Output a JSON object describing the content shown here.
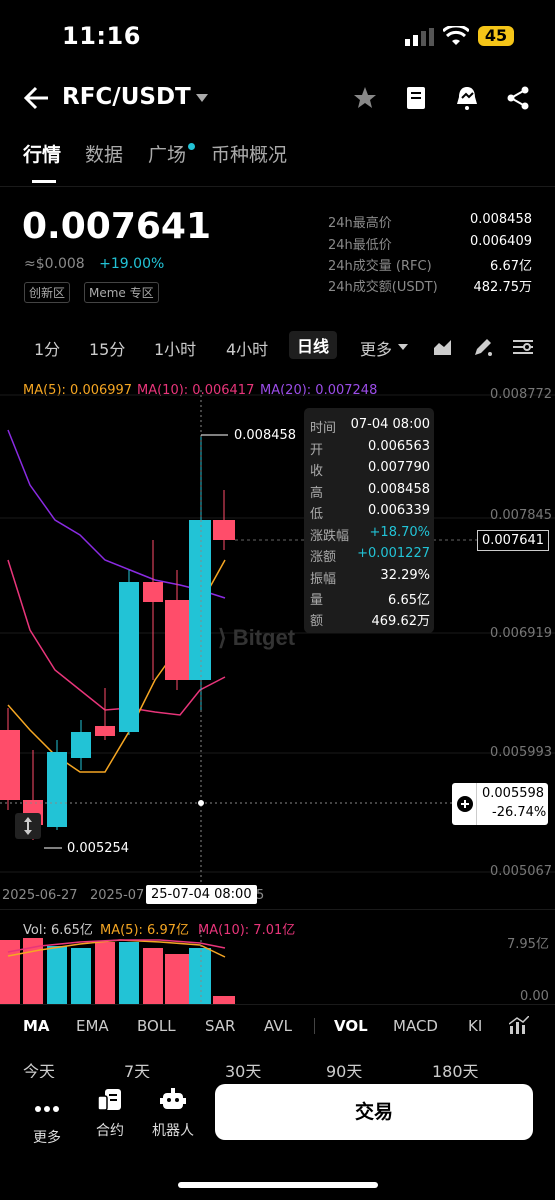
{
  "status_bar": {
    "time": "11:16",
    "battery": "45"
  },
  "header": {
    "pair": "RFC/USDT"
  },
  "tabs": [
    "行情",
    "数据",
    "广场",
    "币种概况"
  ],
  "price": {
    "last": "0.007641",
    "fiat": "≈$0.008",
    "change": "+19.00%",
    "tags": [
      "创新区",
      "Meme 专区"
    ]
  },
  "stats": [
    {
      "label": "24h最高价",
      "value": "0.008458"
    },
    {
      "label": "24h最低价",
      "value": "0.006409"
    },
    {
      "label": "24h成交量 (RFC)",
      "value": "6.67亿"
    },
    {
      "label": "24h成交额(USDT)",
      "value": "482.75万"
    }
  ],
  "intervals": [
    "1分",
    "15分",
    "1小时",
    "4小时",
    "日线",
    "更多"
  ],
  "ma_legend": {
    "ma5": "MA(5): 0.006997",
    "ma10": "MA(10): 0.006417",
    "ma20": "MA(20): 0.007248"
  },
  "axis_right": [
    "0.008772",
    "0.007845",
    "0.006919",
    "0.005993",
    "0.005067"
  ],
  "current_price_tag": "0.007641",
  "high_marker": "0.008458",
  "low_marker": "0.005254",
  "crosshair": {
    "price": "0.005598",
    "pct": "-26.74%",
    "date": "25-07-04 08:00"
  },
  "x_dates": [
    "2025-06-27",
    "2025-07",
    "5"
  ],
  "tooltip": [
    {
      "k": "时间",
      "v": "07-04 08:00"
    },
    {
      "k": "开",
      "v": "0.006563"
    },
    {
      "k": "收",
      "v": "0.007790"
    },
    {
      "k": "高",
      "v": "0.008458"
    },
    {
      "k": "低",
      "v": "0.006339"
    },
    {
      "k": "涨跌幅",
      "v": "+18.70%"
    },
    {
      "k": "涨额",
      "v": "+0.001227"
    },
    {
      "k": "振幅",
      "v": "32.29%"
    },
    {
      "k": "量",
      "v": "6.65亿"
    },
    {
      "k": "额",
      "v": "469.62万"
    }
  ],
  "vol_legend": {
    "vol": "Vol: 6.65亿",
    "ma5": "MA(5): 6.97亿",
    "ma10": "MA(10): 7.01亿",
    "top": "7.95亿",
    "bottom": "0.00"
  },
  "indicator_tabs": [
    "MA",
    "EMA",
    "BOLL",
    "SAR",
    "AVL",
    "VOL",
    "MACD",
    "KI"
  ],
  "ranges": [
    "今天",
    "7天",
    "30天",
    "90天",
    "180天"
  ],
  "bottom": {
    "more": "更多",
    "contract": "合约",
    "robot": "机器人",
    "trade": "交易"
  },
  "watermark": "Bitget",
  "colors": {
    "up": "#22c3d6",
    "down": "#ff4d6a",
    "ma5": "#f5a623",
    "ma10": "#e8357a",
    "ma20": "#8a2be2"
  }
}
